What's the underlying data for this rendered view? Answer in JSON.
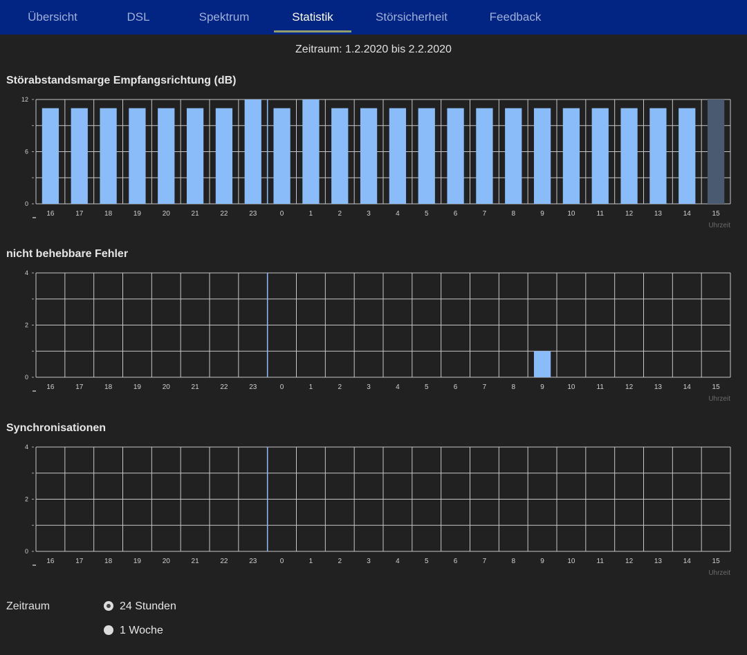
{
  "nav": {
    "tabs": [
      {
        "label": "Übersicht",
        "active": false
      },
      {
        "label": "DSL",
        "active": false
      },
      {
        "label": "Spektrum",
        "active": false
      },
      {
        "label": "Statistik",
        "active": true
      },
      {
        "label": "Störsicherheit",
        "active": false
      },
      {
        "label": "Feedback",
        "active": false
      }
    ]
  },
  "period_text": "Zeitraum: 1.2.2020 bis 2.2.2020",
  "colors": {
    "nav_bg": "#022483",
    "bar": "#8bbcfa",
    "bar_current": "#4a5a70",
    "grid": "#c8c8c8",
    "background": "#212121"
  },
  "charts": {
    "snr": {
      "title": "Störabstandsmarge Empfangsrichtung (dB)"
    },
    "errors": {
      "title": "nicht behebbare Fehler"
    },
    "sync": {
      "title": "Synchronisationen"
    }
  },
  "chart_data": [
    {
      "type": "bar",
      "title": "Störabstandsmarge Empfangsrichtung (dB)",
      "xlabel": "Uhrzeit",
      "ylabel": "",
      "ylim": [
        0,
        12
      ],
      "yticks": [
        "0",
        "6",
        "12"
      ],
      "grid": true,
      "categories": [
        "16",
        "17",
        "18",
        "19",
        "20",
        "21",
        "22",
        "23",
        "0",
        "1",
        "2",
        "3",
        "4",
        "5",
        "6",
        "7",
        "8",
        "9",
        "10",
        "11",
        "12",
        "13",
        "14",
        "15"
      ],
      "values": [
        11,
        11,
        11,
        11,
        11,
        11,
        11,
        12,
        11,
        12,
        11,
        11,
        11,
        11,
        11,
        11,
        11,
        11,
        11,
        11,
        11,
        11,
        11,
        12
      ],
      "current_hour_index": 23
    },
    {
      "type": "bar",
      "title": "nicht behebbare Fehler",
      "xlabel": "Uhrzeit",
      "ylabel": "",
      "ylim": [
        0,
        4
      ],
      "yticks": [
        "0",
        "2",
        "4"
      ],
      "grid": true,
      "categories": [
        "16",
        "17",
        "18",
        "19",
        "20",
        "21",
        "22",
        "23",
        "0",
        "1",
        "2",
        "3",
        "4",
        "5",
        "6",
        "7",
        "8",
        "9",
        "10",
        "11",
        "12",
        "13",
        "14",
        "15"
      ],
      "values": [
        0,
        0,
        0,
        0,
        0,
        0,
        0,
        0,
        0,
        0,
        0,
        0,
        0,
        0,
        0,
        0,
        0,
        1,
        0,
        0,
        0,
        0,
        0,
        0
      ]
    },
    {
      "type": "bar",
      "title": "Synchronisationen",
      "xlabel": "Uhrzeit",
      "ylabel": "",
      "ylim": [
        0,
        4
      ],
      "yticks": [
        "0",
        "2",
        "4"
      ],
      "grid": true,
      "categories": [
        "16",
        "17",
        "18",
        "19",
        "20",
        "21",
        "22",
        "23",
        "0",
        "1",
        "2",
        "3",
        "4",
        "5",
        "6",
        "7",
        "8",
        "9",
        "10",
        "11",
        "12",
        "13",
        "14",
        "15"
      ],
      "values": [
        0,
        0,
        0,
        0,
        0,
        0,
        0,
        0,
        0,
        0,
        0,
        0,
        0,
        0,
        0,
        0,
        0,
        0,
        0,
        0,
        0,
        0,
        0,
        0
      ]
    }
  ],
  "footer": {
    "zeitraum_label": "Zeitraum",
    "options": [
      {
        "label": "24 Stunden",
        "checked": true
      },
      {
        "label": "1 Woche",
        "checked": false
      }
    ]
  }
}
